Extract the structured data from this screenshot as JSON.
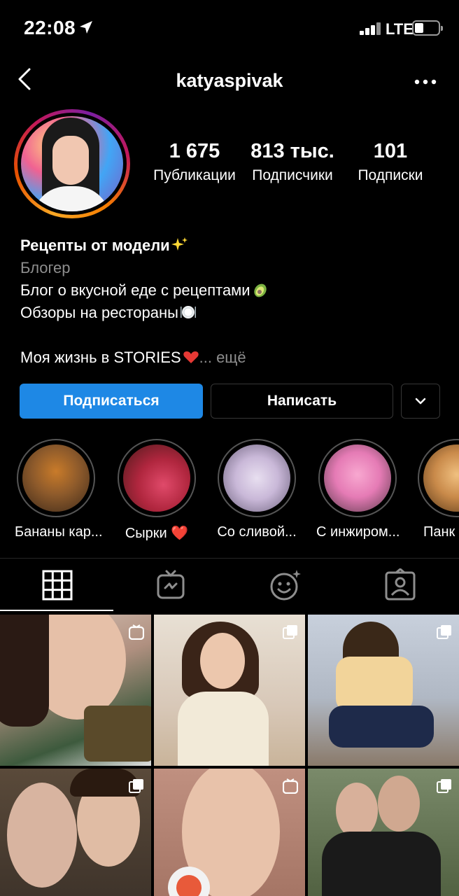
{
  "status_bar": {
    "time": "22:08",
    "network": "LTE"
  },
  "header": {
    "username": "katyaspivak"
  },
  "stats": [
    {
      "value": "1 675",
      "label": "Публикации"
    },
    {
      "value": "813 тыс.",
      "label": "Подписчики"
    },
    {
      "value": "101",
      "label": "Подписки"
    }
  ],
  "bio": {
    "name": "Рецепты от модели",
    "category": "Блогер",
    "line1": "Блог о вкусной еде с рецептами",
    "line2": "Обзоры на рестораны",
    "line3": "Моя жизнь в STORIES",
    "more": "... ещё"
  },
  "buttons": {
    "follow": "Подписаться",
    "message": "Написать"
  },
  "highlights": [
    {
      "label": "Бананы кар...",
      "color": "#8d5a2b"
    },
    {
      "label": "Сырки ❤️",
      "color": "#b0263e"
    },
    {
      "label": "Со сливой...",
      "color": "#c9b8d8"
    },
    {
      "label": "С инжиром...",
      "color": "#e57bb5"
    },
    {
      "label": "Панк",
      "color": "#c98a4a"
    }
  ],
  "tabs": [
    "grid-icon",
    "igtv-icon",
    "reels-icon",
    "tagged-icon"
  ],
  "colors": {
    "accent": "#1e88e5",
    "background": "#000000",
    "muted": "#8e8e8e"
  }
}
